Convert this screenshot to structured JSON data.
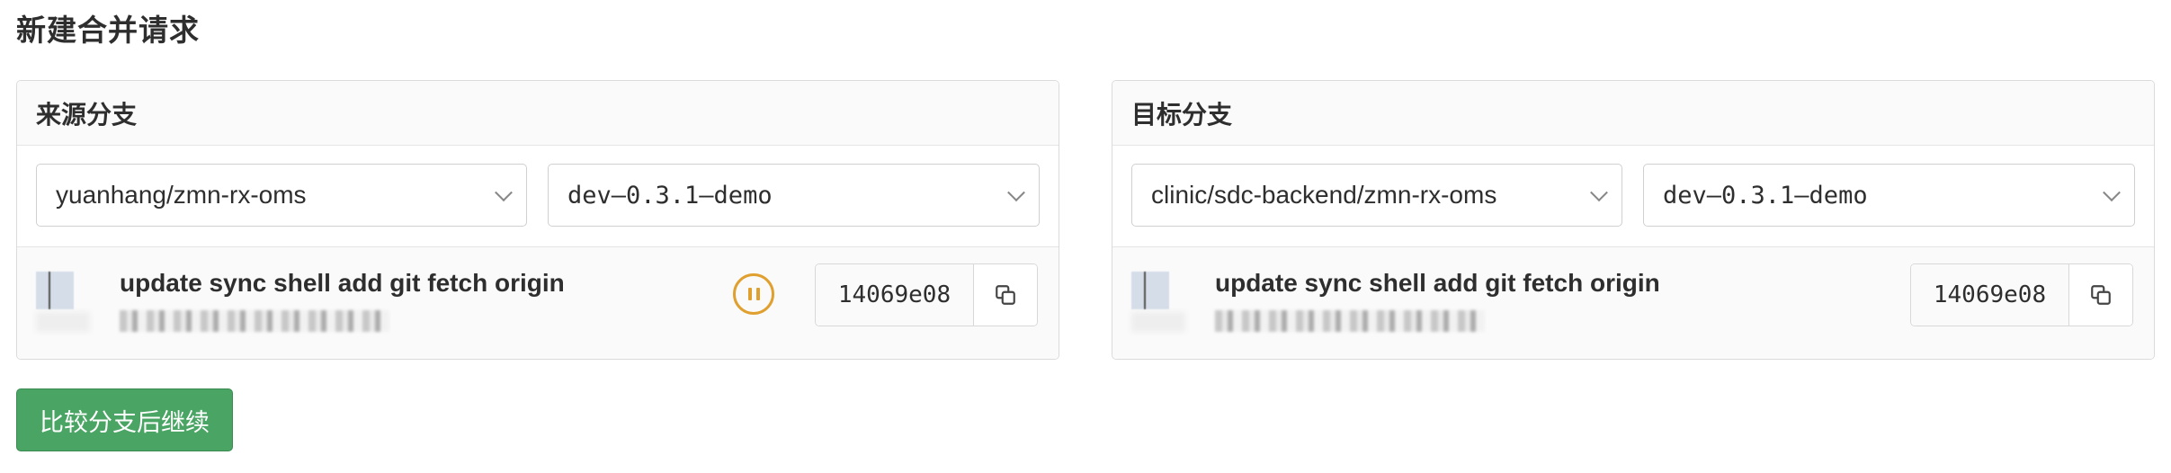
{
  "page": {
    "title": "新建合并请求"
  },
  "source": {
    "header": "来源分支",
    "project": "yuanhang/zmn-rx-oms",
    "branch": "dev–0.3.1–demo",
    "commit": {
      "message": "update sync shell add git fetch origin",
      "sha": "14069e08",
      "pipeline_status": "paused",
      "avatar_icon": "avatar-icon",
      "copy_icon": "copy-icon"
    }
  },
  "target": {
    "header": "目标分支",
    "project": "clinic/sdc-backend/zmn-rx-oms",
    "branch": "dev–0.3.1–demo",
    "commit": {
      "message": "update sync shell add git fetch origin",
      "sha": "14069e08",
      "avatar_icon": "avatar-icon",
      "copy_icon": "copy-icon"
    }
  },
  "actions": {
    "compare_label": "比较分支后继续"
  },
  "colors": {
    "primary_button": "#4aa564",
    "pipeline_paused": "#e0a030",
    "panel_bg": "#fafafa",
    "border": "#dbdbdb"
  }
}
